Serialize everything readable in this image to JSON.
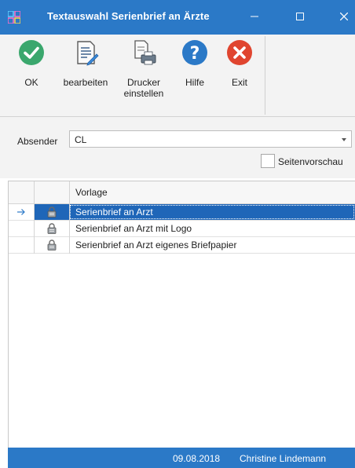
{
  "window": {
    "title": "Textauswahl Serienbrief an Ärzte",
    "controls": [
      "minimize-icon",
      "maximize-icon",
      "close-icon"
    ],
    "accent_color": "#2b79c7"
  },
  "ribbon": {
    "buttons": [
      {
        "id": "ok",
        "label": "OK",
        "icon": "check-circle-icon",
        "color": "#3aa76d"
      },
      {
        "id": "edit",
        "label": "bearbeiten",
        "icon": "document-edit-icon"
      },
      {
        "id": "printer",
        "label_line1": "Drucker",
        "label_line2": "einstellen",
        "icon": "printer-settings-icon"
      },
      {
        "id": "help",
        "label": "Hilfe",
        "icon": "question-circle-icon",
        "color": "#2b79c7"
      },
      {
        "id": "exit",
        "label": "Exit",
        "icon": "close-circle-icon",
        "color": "#e0452f"
      }
    ]
  },
  "filter": {
    "absender_label": "Absender",
    "absender_value": "CL",
    "preview_label": "Seitenvorschau",
    "preview_checked": false
  },
  "grid": {
    "column_header": "Vorlage",
    "rows": [
      {
        "label": "Serienbrief an Arzt",
        "selected": true,
        "icon": "lock-icon"
      },
      {
        "label": "Serienbrief an Arzt mit Logo",
        "selected": false,
        "icon": "lock-icon"
      },
      {
        "label": "Serienbrief an Arzt eigenes Briefpapier",
        "selected": false,
        "icon": "lock-icon"
      }
    ],
    "selection_color": "#1f66b8"
  },
  "status": {
    "date": "09.08.2018",
    "user": "Christine Lindemann"
  }
}
